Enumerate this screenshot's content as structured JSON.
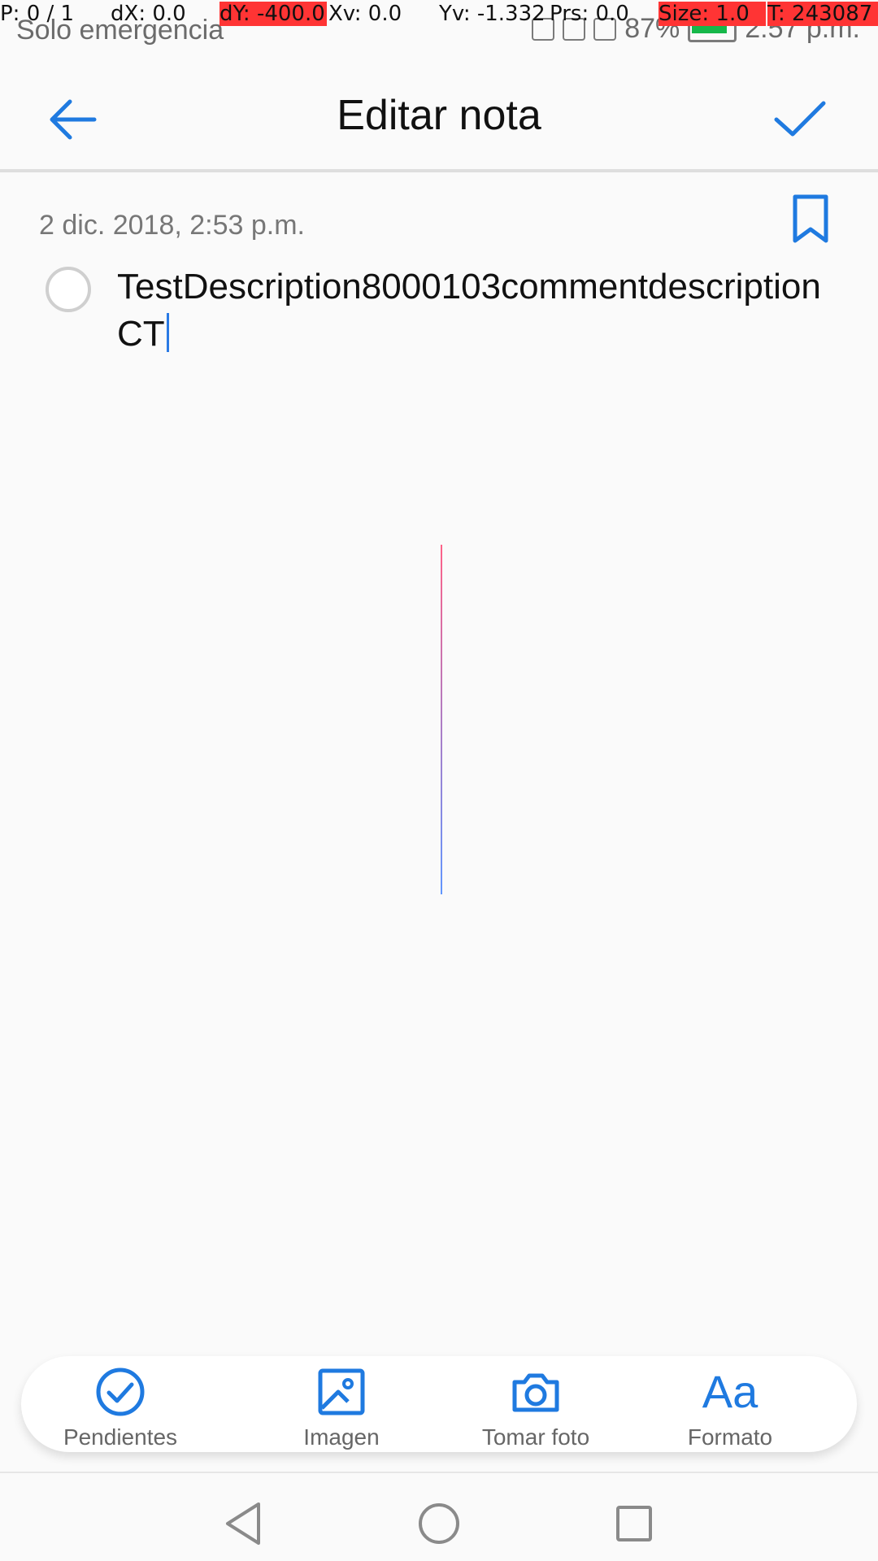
{
  "status_bar": {
    "carrier": "Solo emergencia",
    "battery": "87%",
    "time": "2:57 p.m."
  },
  "debug": {
    "p": "P: 0 / 1",
    "dx": "dX: 0.0",
    "dy": "dY: -400.0",
    "xv": "Xv: 0.0",
    "yv": "Yv: -1.332",
    "prs": "Prs: 0.0",
    "size": "Size: 1.0",
    "t": "T: 243087"
  },
  "app_bar": {
    "title": "Editar nota",
    "back_icon": "arrow-left-icon",
    "save_icon": "check-icon"
  },
  "note": {
    "date": "2 dic. 2018, 2:53 p.m.",
    "text": "TestDescription8000103commentdescription CT"
  },
  "toolbar": {
    "items": [
      {
        "label": "Pendientes",
        "icon": "checkbox-circle-icon"
      },
      {
        "label": "Imagen",
        "icon": "image-icon"
      },
      {
        "label": "Tomar foto",
        "icon": "camera-icon"
      },
      {
        "label": "Formato",
        "icon": "format-aa-icon",
        "glyph": "Aa"
      }
    ]
  },
  "colors": {
    "accent": "#1f7ae0",
    "background": "#fafafa"
  }
}
